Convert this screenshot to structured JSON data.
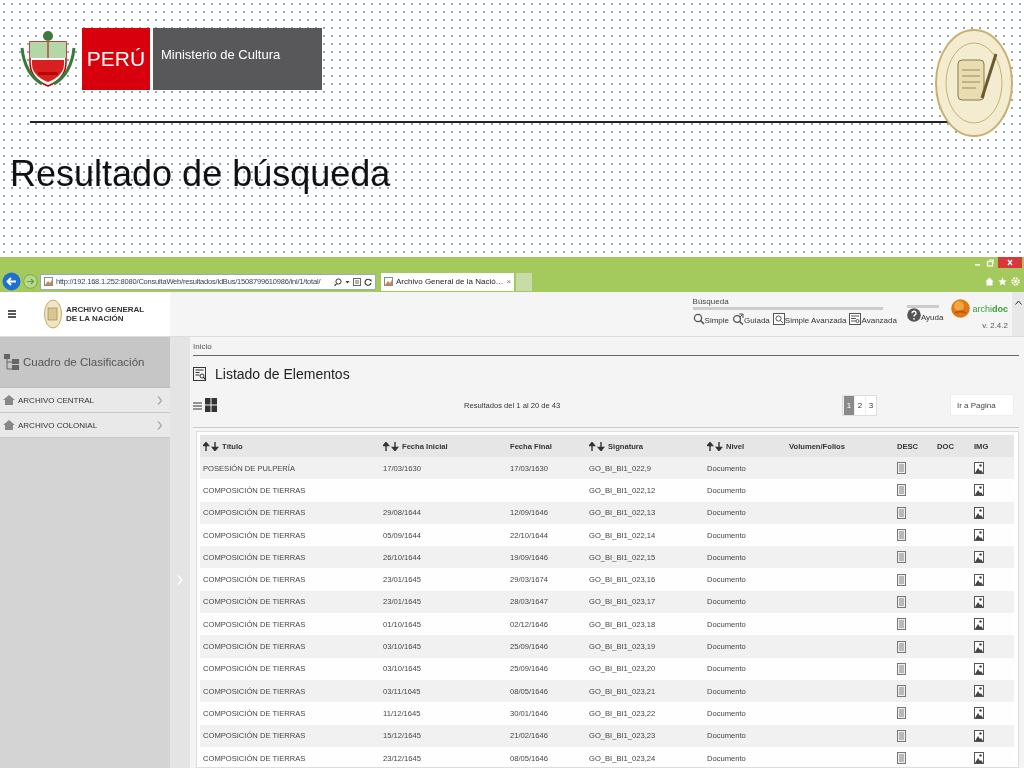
{
  "slide": {
    "brand": {
      "country": "PERÚ",
      "ministry": "Ministerio de Cultura"
    },
    "title": "Resultado de búsqueda"
  },
  "browser": {
    "url": "http://192.168.1.252:8080/ConsultaWeb/resultados/idBus/1508799610986/ini/1/total/",
    "tabs": [
      {
        "title": "Archivo General de la Nació…",
        "close": "×",
        "selected": true
      }
    ]
  },
  "app": {
    "logo_lines": [
      "ARCHIVO GENERAL",
      "DE LA NACIÓN"
    ],
    "search_label": "Búsqueda",
    "search_links": [
      {
        "label": "Simple",
        "kind": "simple"
      },
      {
        "label": "Guiada",
        "kind": "guided"
      },
      {
        "label": "Simple Avanzada",
        "kind": "frame"
      },
      {
        "label": "Avanzada",
        "kind": "form"
      }
    ],
    "help": "Ayuda",
    "product": {
      "prefix": "archi",
      "suffix": "doc"
    },
    "version": "v. 2.4.2"
  },
  "sidebar": {
    "heading": "Cuadro de Clasificación",
    "items": [
      {
        "label": "ARCHIVO CENTRAL"
      },
      {
        "label": "ARCHIVO COLONIAL"
      }
    ]
  },
  "main": {
    "breadcrumb": "Inicio",
    "heading": "Listado de Elementos",
    "results": "Resultados del 1 al 20 de 43",
    "pages": [
      {
        "label": "1",
        "selected": true
      },
      {
        "label": "2",
        "selected": false
      },
      {
        "label": "3",
        "selected": false
      }
    ],
    "goto": {
      "placeholder": "Ir a Pagina"
    }
  },
  "table": {
    "columns": [
      {
        "label": "Título",
        "sortable": true
      },
      {
        "label": "Fecha Inicial",
        "sortable": true
      },
      {
        "label": "Fecha Final",
        "sortable": false
      },
      {
        "label": "Signatura",
        "sortable": true
      },
      {
        "label": "Nivel",
        "sortable": true
      },
      {
        "label": "Volumen/Folios",
        "sortable": false
      },
      {
        "label": "DESC",
        "sortable": false
      },
      {
        "label": "DOC",
        "sortable": false
      },
      {
        "label": "IMG",
        "sortable": false
      }
    ],
    "rows": [
      {
        "title": "POSESIÓN DE PULPERÍA",
        "start_date": "17/03/1630",
        "end_date": "17/03/1630",
        "signature": "GO_BI_BI1_022,9",
        "nivel": "Documento",
        "desc": true,
        "doc": false,
        "img": true
      },
      {
        "title": "COMPOSICIÓN DE TIERRAS",
        "signature": "GO_BI_BI1_022,12",
        "nivel": "Documento",
        "desc": true,
        "doc": false,
        "img": true
      },
      {
        "title": "COMPOSICIÓN DE TIERRAS",
        "start_date": "29/08/1644",
        "end_date": "12/09/1646",
        "signature": "GO_BI_BI1_022,13",
        "nivel": "Documento",
        "desc": true,
        "doc": false,
        "img": true
      },
      {
        "title": "COMPOSICIÓN DE TIERRAS",
        "start_date": "05/09/1644",
        "end_date": "22/10/1644",
        "signature": "GO_BI_BI1_022,14",
        "nivel": "Documento",
        "desc": true,
        "doc": false,
        "img": true
      },
      {
        "title": "COMPOSICIÓN DE TIERRAS",
        "start_date": "26/10/1644",
        "end_date": "19/09/1646",
        "signature": "GO_BI_BI1_022,15",
        "nivel": "Documento",
        "desc": true,
        "doc": false,
        "img": true
      },
      {
        "title": "COMPOSICIÓN DE TIERRAS",
        "start_date": "23/01/1645",
        "end_date": "29/03/1674",
        "signature": "GO_BI_BI1_023,16",
        "nivel": "Documento",
        "desc": true,
        "doc": false,
        "img": true
      },
      {
        "title": "COMPOSICIÓN DE TIERRAS",
        "start_date": "23/01/1645",
        "end_date": "28/03/1647",
        "signature": "GO_BI_BI1_023,17",
        "nivel": "Documento",
        "desc": true,
        "doc": false,
        "img": true
      },
      {
        "title": "COMPOSICIÓN DE TIERRAS",
        "start_date": "01/10/1645",
        "end_date": "02/12/1646",
        "signature": "GO_BI_BI1_023,18",
        "nivel": "Documento",
        "desc": true,
        "doc": false,
        "img": true
      },
      {
        "title": "COMPOSICIÓN DE TIERRAS",
        "start_date": "03/10/1645",
        "end_date": "25/09/1646",
        "signature": "GO_BI_BI1_023,19",
        "nivel": "Documento",
        "desc": true,
        "doc": false,
        "img": true
      },
      {
        "title": "COMPOSICIÓN DE TIERRAS",
        "start_date": "03/10/1645",
        "end_date": "25/09/1646",
        "signature": "GO_BI_BI1_023,20",
        "nivel": "Documento",
        "desc": true,
        "doc": false,
        "img": true
      },
      {
        "title": "COMPOSICIÓN DE TIERRAS",
        "start_date": "03/11/1645",
        "end_date": "08/05/1646",
        "signature": "GO_BI_BI1_023,21",
        "nivel": "Documento",
        "desc": true,
        "doc": false,
        "img": true
      },
      {
        "title": "COMPOSICIÓN DE TIERRAS",
        "start_date": "11/12/1645",
        "end_date": "30/01/1646",
        "signature": "GO_BI_BI1_023,22",
        "nivel": "Documento",
        "desc": true,
        "doc": false,
        "img": true
      },
      {
        "title": "COMPOSICIÓN DE TIERRAS",
        "start_date": "15/12/1645",
        "end_date": "21/02/1646",
        "signature": "GO_BI_BI1_023,23",
        "nivel": "Documento",
        "desc": true,
        "doc": false,
        "img": true
      },
      {
        "title": "COMPOSICIÓN DE TIERRAS",
        "start_date": "23/12/1645",
        "end_date": "08/05/1646",
        "signature": "GO_BI_BI1_023,24",
        "nivel": "Documento",
        "desc": true,
        "doc": false,
        "img": true
      }
    ]
  }
}
